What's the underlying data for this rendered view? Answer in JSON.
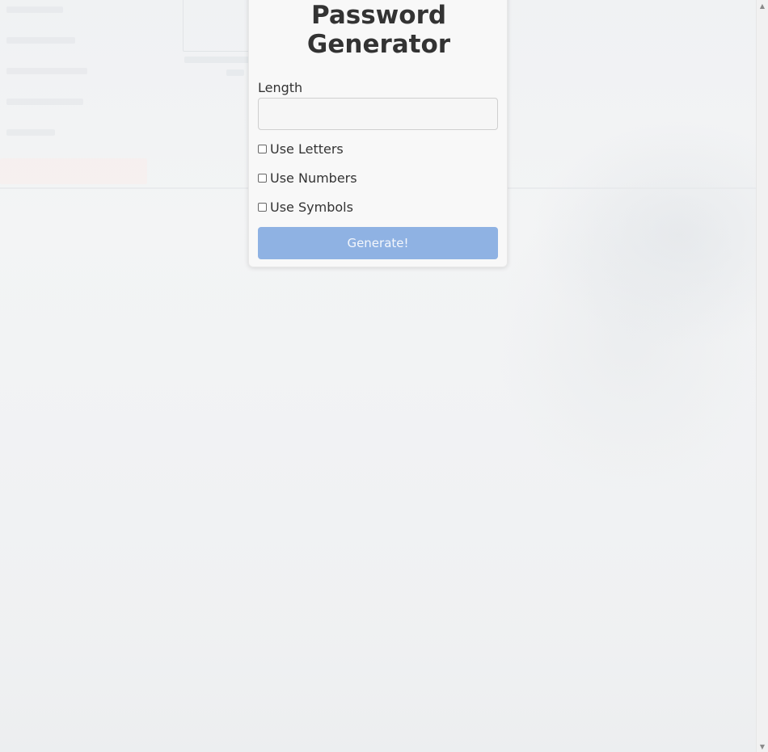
{
  "card": {
    "title_line1": "Password",
    "title_line2": "Generator",
    "length_label": "Length",
    "length_value": "",
    "options": [
      {
        "label": "Use Letters",
        "checked": false
      },
      {
        "label": "Use Numbers",
        "checked": false
      },
      {
        "label": "Use Symbols",
        "checked": false
      }
    ],
    "generate_label": "Generate!"
  },
  "scrollbar": {
    "up_icon": "chevron-up-icon",
    "down_icon": "chevron-down-icon"
  },
  "colors": {
    "button": "#8fb2e3",
    "card_background": "#f8f8f8",
    "page_background": "#f3f4f5",
    "text": "#333333"
  }
}
